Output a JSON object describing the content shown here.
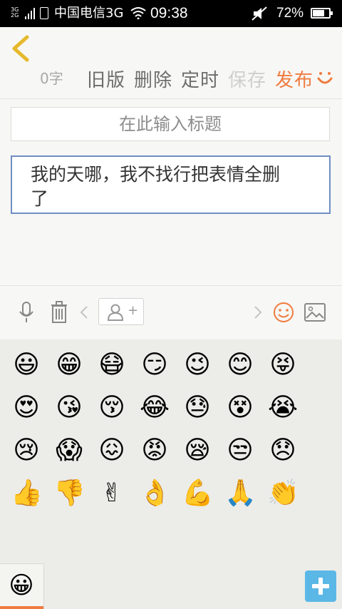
{
  "status_bar": {
    "network_top": "3G",
    "network_bottom": "2G",
    "carrier": "中国电信3G",
    "time": "09:38",
    "battery": "72%",
    "battery_level": 0.72
  },
  "toolbar": {
    "word_count": "0字",
    "old_version": "旧版",
    "delete": "删除",
    "schedule": "定时",
    "save": "保存",
    "publish": "发布"
  },
  "editor": {
    "title_placeholder": "在此输入标题",
    "content_line1": "我的天哪，我不找行把表情全删",
    "content_line2": "了"
  },
  "emoji_panel": {
    "rows": [
      [
        "😃",
        "😁",
        "😷",
        "😏",
        "😉",
        "😊",
        "😝"
      ],
      [
        "😍",
        "😘",
        "😚",
        "😂",
        "😓",
        "😵",
        "😭"
      ],
      [
        "😢",
        "😱",
        "😖",
        "😡",
        "😪",
        "😒",
        "😞"
      ],
      [
        "👍",
        "👎",
        "✌",
        "👌",
        "💪",
        "🙏",
        "👏"
      ]
    ],
    "tab_icon": "😀"
  },
  "colors": {
    "accent": "#f07b3f",
    "back_icon": "#e6b92b",
    "editor_border": "#6f8ec4",
    "add_button": "#5bb8e6"
  },
  "icons": [
    "back-arrow-icon",
    "smile-icon",
    "microphone-icon",
    "trash-icon",
    "chevron-left-icon",
    "mention-user-icon",
    "chevron-right-icon",
    "emoji-face-icon",
    "image-icon",
    "add-icon"
  ]
}
